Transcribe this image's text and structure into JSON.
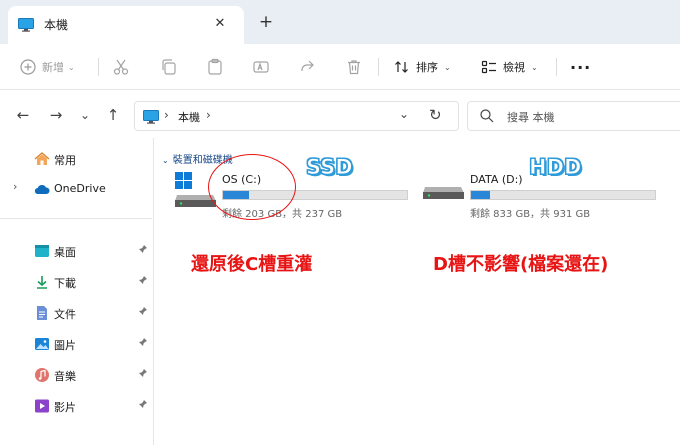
{
  "tab": {
    "title": "本機",
    "close": "✕",
    "new": "+"
  },
  "toolbar": {
    "new_label": "新增",
    "sort_label": "排序",
    "view_label": "檢視",
    "more": "···"
  },
  "nav": {
    "back": "←",
    "forward": "→",
    "recent": "⌄",
    "up": "↑"
  },
  "address": {
    "sep": "›",
    "location": "本機",
    "chevron": "⌄",
    "refresh": "↻"
  },
  "search": {
    "placeholder": "搜尋 本機"
  },
  "sidebar": {
    "items": [
      {
        "label": "常用",
        "icon": "home-icon"
      },
      {
        "label": "OneDrive",
        "icon": "cloud-icon",
        "expand": "›"
      },
      {
        "label": "桌面",
        "icon": "desktop-icon",
        "pin": "📌"
      },
      {
        "label": "下載",
        "icon": "download-icon",
        "pin": "📌"
      },
      {
        "label": "文件",
        "icon": "document-icon",
        "pin": "📌"
      },
      {
        "label": "圖片",
        "icon": "pictures-icon",
        "pin": "📌"
      },
      {
        "label": "音樂",
        "icon": "music-icon",
        "pin": "📌"
      },
      {
        "label": "影片",
        "icon": "videos-icon",
        "pin": "📌"
      }
    ]
  },
  "group": {
    "caret": "⌄",
    "title": "裝置和磁碟機"
  },
  "drives": [
    {
      "name": "OS (C:)",
      "free": "剩餘 203 GB，共 237 GB",
      "used_fraction": 0.14,
      "icon": "windows-drive-icon"
    },
    {
      "name": "DATA (D:)",
      "free": "剩餘 833 GB，共 931 GB",
      "used_fraction": 0.105,
      "icon": "hard-drive-icon"
    }
  ],
  "annotations": {
    "ssd": "SSD",
    "hdd": "HDD",
    "c_note": "還原後C槽重灌",
    "d_note": "D槽不影響(檔案還在)"
  },
  "colors": {
    "accent": "#2a86d6",
    "annotation_red": "#e81414",
    "annotation_blue": "#2f9bd8"
  }
}
